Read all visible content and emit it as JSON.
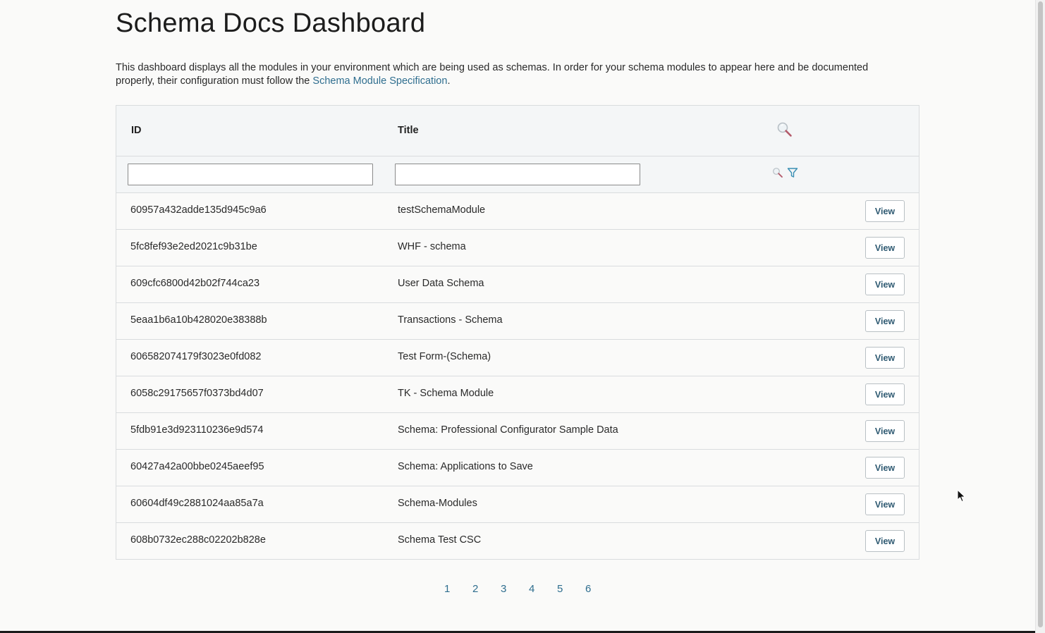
{
  "page": {
    "title": "Schema Docs Dashboard",
    "description_prefix": "This dashboard displays all the modules in your environment which are being used as schemas. In order for your schema modules to appear here and be documented properly, their configuration must follow the ",
    "description_link": "Schema Module Specification",
    "description_suffix": "."
  },
  "table": {
    "columns": {
      "id": "ID",
      "title": "Title"
    },
    "filters": {
      "id_value": "",
      "title_value": ""
    },
    "view_label": "View",
    "rows": [
      {
        "id": "60957a432adde135d945c9a6",
        "title": "testSchemaModule"
      },
      {
        "id": "5fc8fef93e2ed2021c9b31be",
        "title": "WHF - schema"
      },
      {
        "id": "609cfc6800d42b02f744ca23",
        "title": "User Data Schema"
      },
      {
        "id": "5eaa1b6a10b428020e38388b",
        "title": "Transactions - Schema"
      },
      {
        "id": "606582074179f3023e0fd082",
        "title": "Test Form-(Schema)"
      },
      {
        "id": "6058c29175657f0373bd4d07",
        "title": "TK - Schema Module"
      },
      {
        "id": "5fdb91e3d923110236e9d574",
        "title": "Schema: Professional Configurator Sample Data"
      },
      {
        "id": "60427a42a00bbe0245aeef95",
        "title": "Schema: Applications to Save"
      },
      {
        "id": "60604df49c2881024aa85a7a",
        "title": "Schema-Modules"
      },
      {
        "id": "608b0732ec288c02202b828e",
        "title": "Schema Test CSC"
      }
    ]
  },
  "pagination": {
    "pages": [
      "1",
      "2",
      "3",
      "4",
      "5",
      "6"
    ]
  },
  "icons": {
    "header_search": "search-icon",
    "filter_search": "search-icon",
    "filter": "funnel-icon"
  },
  "colors": {
    "link": "#2f6e8f",
    "button_text": "#2f5a72",
    "border": "#d9dcde",
    "header_bg": "#f4f6f7"
  }
}
